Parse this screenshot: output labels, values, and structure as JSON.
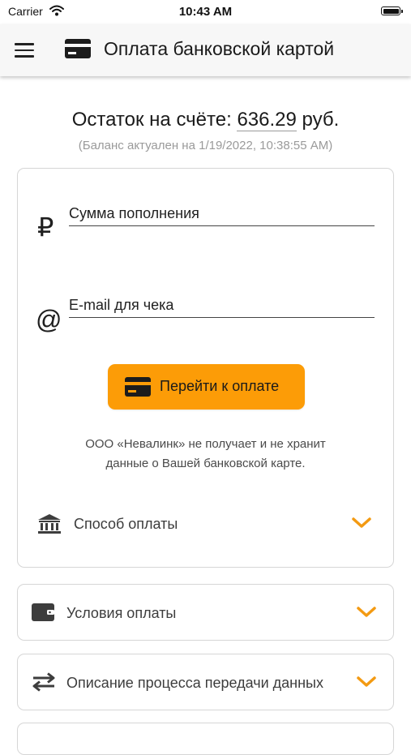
{
  "status_bar": {
    "carrier": "Carrier",
    "time": "10:43 AM"
  },
  "header": {
    "title": "Оплата банковской картой",
    "menu_icon": "hamburger-menu-icon",
    "card_icon": "credit-card-icon"
  },
  "balance": {
    "label": "Остаток на счёте:",
    "amount": "636.29",
    "currency": "руб.",
    "note": "(Баланс актуален на 1/19/2022, 10:38:55 AM)"
  },
  "form": {
    "amount_placeholder": "Сумма пополнения",
    "amount_value": "",
    "amount_icon_symbol": "₽",
    "email_placeholder": "E-mail для чека",
    "email_value": "",
    "email_icon_symbol": "@",
    "pay_button_label": "Перейти к оплате",
    "disclaimer_line1": "ООО «Невалинк» не получает и не хранит",
    "disclaimer_line2": "данные о Вашей банковской карте."
  },
  "accordions": {
    "payment_method": "Способ оплаты",
    "payment_terms": "Условия оплаты",
    "data_transfer": "Описание процесса передачи данных"
  },
  "colors": {
    "accent": "#fc9c07",
    "chevron": "#f39a12",
    "text": "#1c1c1c",
    "muted": "#9a9a9a"
  }
}
